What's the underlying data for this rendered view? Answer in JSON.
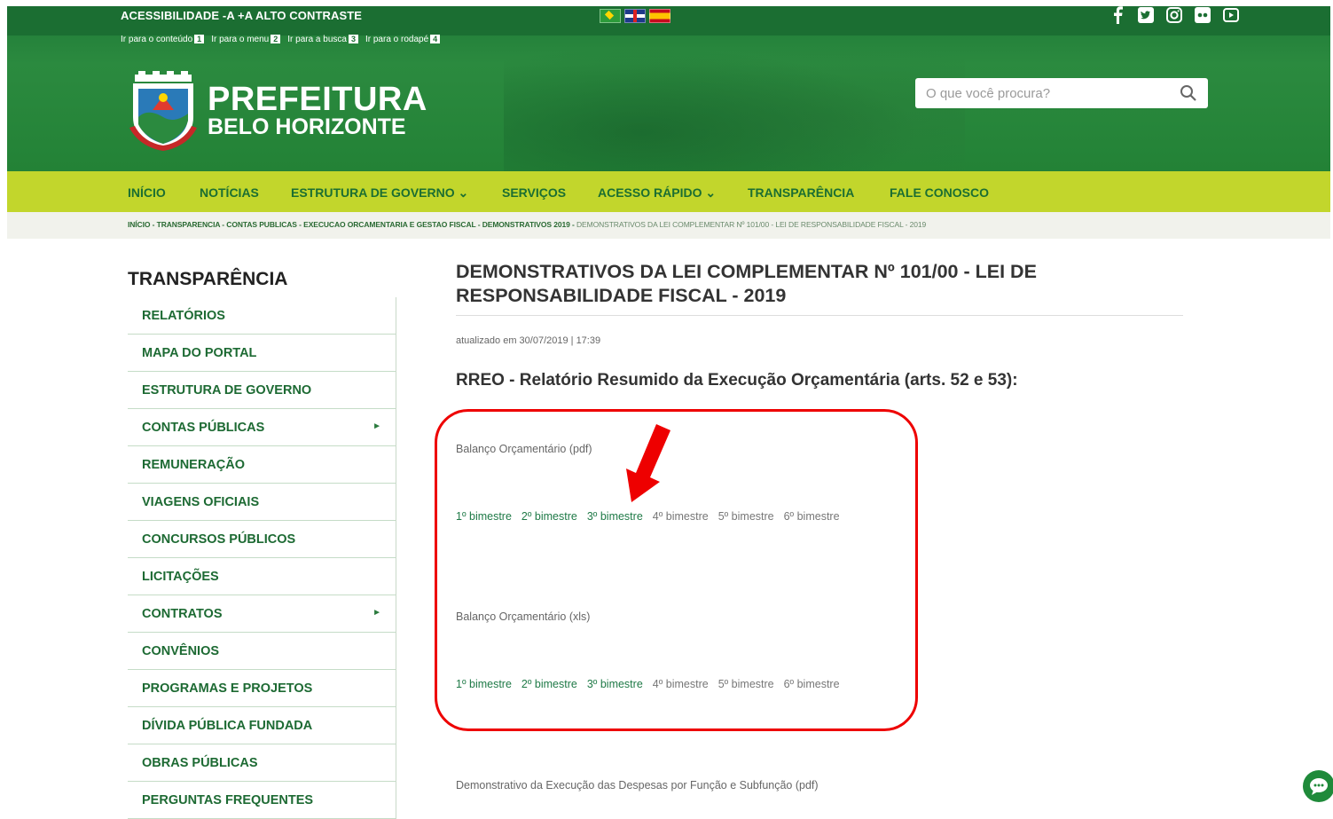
{
  "header": {
    "accessibility_text": "ACESSIBILIDADE -A +A ALTO CONTRASTE",
    "skip_links": [
      {
        "label": "Ir para o conteúdo",
        "num": "1"
      },
      {
        "label": "Ir para o menu",
        "num": "2"
      },
      {
        "label": "Ir para a busca",
        "num": "3"
      },
      {
        "label": "Ir para o rodapé",
        "num": "4"
      }
    ],
    "logo_line1": "PREFEITURA",
    "logo_line2": "BELO HORIZONTE",
    "search_placeholder": "O que você procura?",
    "social_icons": [
      "facebook-icon",
      "twitter-icon",
      "instagram-icon",
      "flickr-icon",
      "youtube-icon"
    ],
    "flags": [
      "brazil-flag-icon",
      "uk-flag-icon",
      "spain-flag-icon"
    ]
  },
  "nav": {
    "items": [
      {
        "label": "INÍCIO"
      },
      {
        "label": "NOTÍCIAS"
      },
      {
        "label": "ESTRUTURA DE GOVERNO ⌄"
      },
      {
        "label": "SERVIÇOS"
      },
      {
        "label": "ACESSO RÁPIDO ⌄"
      },
      {
        "label": "TRANSPARÊNCIA"
      },
      {
        "label": "FALE CONOSCO"
      }
    ]
  },
  "breadcrumb": {
    "path": "INÍCIO - TRANSPARENCIA - CONTAS PUBLICAS - EXECUCAO ORCAMENTARIA E GESTAO FISCAL - DEMONSTRATIVOS 2019 - ",
    "current": "DEMONSTRATIVOS DA LEI COMPLEMENTAR Nº 101/00 - LEI DE RESPONSABILIDADE FISCAL - 2019"
  },
  "sidebar": {
    "title": "TRANSPARÊNCIA",
    "items": [
      {
        "label": "RELATÓRIOS",
        "has_arrow": false
      },
      {
        "label": "MAPA DO PORTAL",
        "has_arrow": false
      },
      {
        "label": "ESTRUTURA DE GOVERNO",
        "has_arrow": false
      },
      {
        "label": "CONTAS PÚBLICAS",
        "has_arrow": true
      },
      {
        "label": "REMUNERAÇÃO",
        "has_arrow": false
      },
      {
        "label": "VIAGENS OFICIAIS",
        "has_arrow": false
      },
      {
        "label": "CONCURSOS PÚBLICOS",
        "has_arrow": false
      },
      {
        "label": "LICITAÇÕES",
        "has_arrow": false
      },
      {
        "label": "CONTRATOS",
        "has_arrow": true
      },
      {
        "label": "CONVÊNIOS",
        "has_arrow": false
      },
      {
        "label": "PROGRAMAS E PROJETOS",
        "has_arrow": false
      },
      {
        "label": "DÍVIDA PÚBLICA FUNDADA",
        "has_arrow": false
      },
      {
        "label": "OBRAS PÚBLICAS",
        "has_arrow": false
      },
      {
        "label": "PERGUNTAS FREQUENTES",
        "has_arrow": false
      }
    ],
    "arrow_glyph": "►"
  },
  "main": {
    "title": "DEMONSTRATIVOS DA LEI COMPLEMENTAR Nº 101/00 - LEI DE RESPONSABILIDADE FISCAL - 2019",
    "updated": "atualizado em 30/07/2019 | 17:39",
    "subtitle": "RREO - Relatório Resumido da Execução Orçamentária (arts. 52 e 53):",
    "sections": [
      {
        "label": "Balanço Orçamentário (pdf)",
        "links": [
          {
            "label": "1º bimestre",
            "active": true
          },
          {
            "label": "2º bimestre",
            "active": true
          },
          {
            "label": "3º bimestre",
            "active": true
          },
          {
            "label": "4º bimestre",
            "active": false
          },
          {
            "label": "5º bimestre",
            "active": false
          },
          {
            "label": "6º bimestre",
            "active": false
          }
        ]
      },
      {
        "label": "Balanço Orçamentário (xls)",
        "links": [
          {
            "label": "1º bimestre",
            "active": true
          },
          {
            "label": "2º bimestre",
            "active": true
          },
          {
            "label": "3º bimestre",
            "active": true
          },
          {
            "label": "4º bimestre",
            "active": false
          },
          {
            "label": "5º bimestre",
            "active": false
          },
          {
            "label": "6º bimestre",
            "active": false
          }
        ]
      }
    ],
    "next_label": "Demonstrativo da Execução das Despesas por Função e Subfunção (pdf)"
  },
  "colors": {
    "header_green": "#238236",
    "nav_lime": "#c2d62c",
    "link_green": "#1f7a47",
    "annotation_red": "#e00000"
  }
}
